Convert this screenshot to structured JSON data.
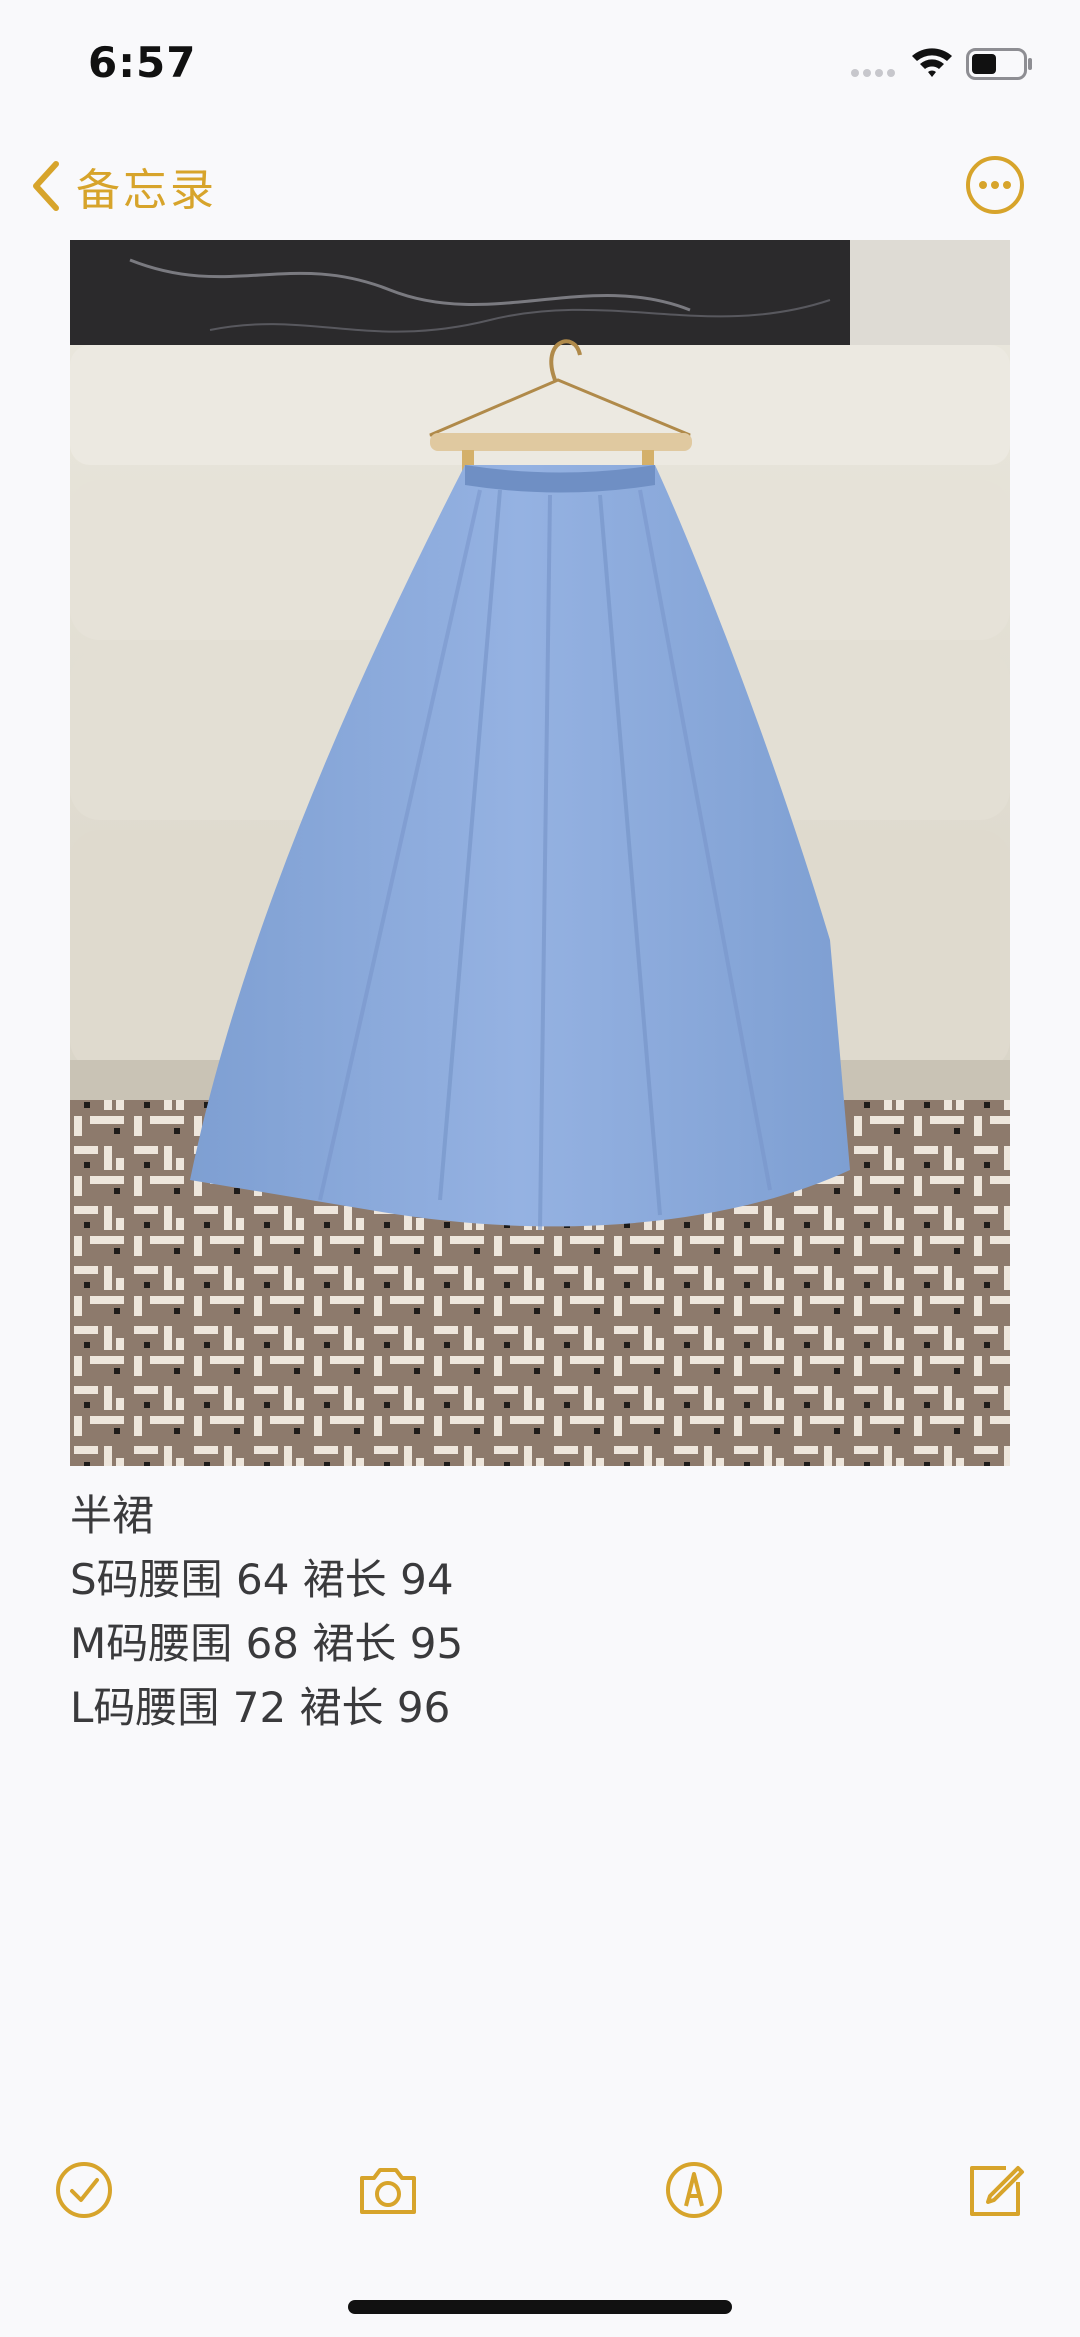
{
  "status_bar": {
    "time": "6:57"
  },
  "nav": {
    "back_label": "备忘录",
    "accent_color": "#d7a42b"
  },
  "note": {
    "image_subject": "light blue pleated midi skirt on wooden hanger over cream sofa, woven-pattern rug below",
    "lines": [
      "半裙",
      "S码腰围 64 裙长 94",
      "M码腰围 68 裙长 95",
      "L码腰围 72 裙长 96"
    ]
  },
  "toolbar": {
    "icons": [
      "checklist-icon",
      "camera-icon",
      "markup-pen-icon",
      "compose-icon"
    ]
  }
}
